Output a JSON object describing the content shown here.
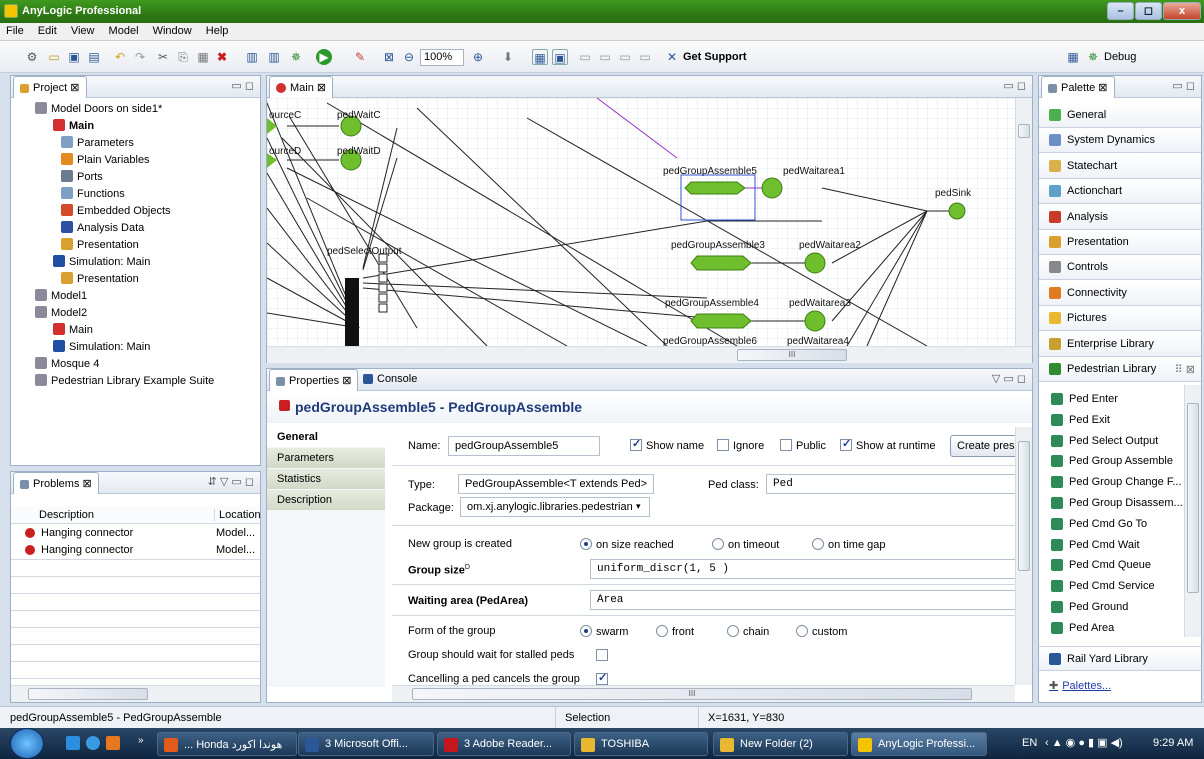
{
  "window": {
    "title": "AnyLogic Professional",
    "min": "–",
    "max": "◻",
    "close": "x"
  },
  "menu": [
    "File",
    "Edit",
    "View",
    "Model",
    "Window",
    "Help"
  ],
  "toolbar": {
    "zoom": "100%",
    "get_support": "Get Support",
    "perspective": "Debug"
  },
  "project": {
    "tab": "Project",
    "items": [
      {
        "label": "Model Doors on side1*",
        "color": "#8a8a9a"
      },
      {
        "label": "Main",
        "color": "#d32f2f",
        "bold": true
      },
      {
        "label": "Parameters",
        "color": "#7ea0c4"
      },
      {
        "label": "Plain Variables",
        "color": "#e58a1f"
      },
      {
        "label": "Ports",
        "color": "#6b7a8f"
      },
      {
        "label": "Functions",
        "color": "#7ea0c4"
      },
      {
        "label": "Embedded Objects",
        "color": "#d34b2a"
      },
      {
        "label": "Analysis Data",
        "color": "#2f4fa3"
      },
      {
        "label": "Presentation",
        "color": "#d9a030"
      },
      {
        "label": "Simulation: Main",
        "color": "#1f4fa3"
      },
      {
        "label": "Presentation",
        "color": "#d9a030"
      },
      {
        "label": "Model1",
        "color": "#8a8a9a"
      },
      {
        "label": "Model2",
        "color": "#8a8a9a"
      },
      {
        "label": "Main",
        "color": "#d32f2f"
      },
      {
        "label": "Simulation: Main",
        "color": "#1f4fa3"
      },
      {
        "label": "Mosque 4",
        "color": "#8a8a9a"
      },
      {
        "label": "Pedestrian Library Example Suite",
        "color": "#8a8a9a"
      }
    ]
  },
  "problems": {
    "tab": "Problems",
    "col_description": "Description",
    "col_location": "Location",
    "rows": [
      {
        "description": "Hanging connector",
        "location": "Model..."
      },
      {
        "description": "Hanging connector",
        "location": "Model..."
      }
    ]
  },
  "editor": {
    "tab": "Main",
    "labels": {
      "sourceC": "ourceC",
      "sourceD": "ourceD",
      "waitC": "pedWaitC",
      "waitD": "pedWaitD",
      "select": "pedSelectOutput",
      "ga5": "pedGroupAssemble5",
      "ga3": "pedGroupAssemble3",
      "ga4": "pedGroupAssemble4",
      "ga6": "pedGroupAssemble6",
      "wa1": "pedWaitarea1",
      "wa2": "pedWaitarea2",
      "wa3": "pedWaitarea3",
      "wa4": "pedWaitarea4",
      "sink": "pedSink"
    },
    "hscroll_mark": "III"
  },
  "properties": {
    "tab": "Properties",
    "console_tab": "Console",
    "title": "pedGroupAssemble5 - PedGroupAssemble",
    "sections": [
      "General",
      "Parameters",
      "Statistics",
      "Description"
    ],
    "name_label": "Name:",
    "name_value": "pedGroupAssemble5",
    "show_name": "Show name",
    "ignore": "Ignore",
    "public": "Public",
    "show_at_runtime": "Show at runtime",
    "create_btn": "Create prese",
    "type_label": "Type:",
    "type_value": "PedGroupAssemble<T extends Ped>",
    "pedclass_label": "Ped class:",
    "pedclass_value": "Ped",
    "package_label": "Package:",
    "package_value": "om.xj.anylogic.libraries.pedestrian",
    "new_group_label": "New group is created",
    "opt_size": "on size reached",
    "opt_timeout": "on timeout",
    "opt_gap": "on time gap",
    "group_size_label": "Group size",
    "group_size_sup": "D",
    "group_size_value": "uniform_discr(1, 5 )",
    "waiting_label": "Waiting area (PedArea)",
    "waiting_value": "Area",
    "form_label": "Form of the group",
    "form_swarm": "swarm",
    "form_front": "front",
    "form_chain": "chain",
    "form_custom": "custom",
    "stalled_label": "Group should wait for stalled peds",
    "cancel_label": "Cancelling a ped cancels the group",
    "hscroll_mark": "III"
  },
  "palette": {
    "tab": "Palette",
    "sections": [
      {
        "label": "General",
        "color": "#4caf50"
      },
      {
        "label": "System Dynamics",
        "color": "#6d8fc8"
      },
      {
        "label": "Statechart",
        "color": "#d9b04a"
      },
      {
        "label": "Actionchart",
        "color": "#5fa0c8"
      },
      {
        "label": "Analysis",
        "color": "#c83a2a"
      },
      {
        "label": "Presentation",
        "color": "#d9a030"
      },
      {
        "label": "Controls",
        "color": "#888888"
      },
      {
        "label": "Connectivity",
        "color": "#e07b20"
      },
      {
        "label": "Pictures",
        "color": "#e8b830"
      },
      {
        "label": "Enterprise Library",
        "color": "#c8a030"
      },
      {
        "label": "Pedestrian Library",
        "color": "#2e8b2e"
      }
    ],
    "ped_items": [
      {
        "label": "Ped Enter",
        "color": "#2e8b57"
      },
      {
        "label": "Ped Exit",
        "color": "#2e8b57"
      },
      {
        "label": "Ped Select Output",
        "color": "#2e8b57"
      },
      {
        "label": "Ped Group Assemble",
        "color": "#2e8b57"
      },
      {
        "label": "Ped Group Change F...",
        "color": "#2e8b57"
      },
      {
        "label": "Ped Group Disassem...",
        "color": "#2e8b57"
      },
      {
        "label": "Ped Cmd Go To",
        "color": "#2e8b57"
      },
      {
        "label": "Ped Cmd Wait",
        "color": "#2e8b57"
      },
      {
        "label": "Ped Cmd Queue",
        "color": "#2e8b57"
      },
      {
        "label": "Ped Cmd Service",
        "color": "#2e8b57"
      },
      {
        "label": "Ped Ground",
        "color": "#2e8b57"
      },
      {
        "label": "Ped Area",
        "color": "#2e8b57"
      }
    ],
    "rail": "Rail Yard Library",
    "palettes_link": "Palettes..."
  },
  "status": {
    "left": "pedGroupAssemble5 - PedGroupAssemble",
    "mode": "Selection",
    "coords": "X=1631, Y=830"
  },
  "taskbar": {
    "tasks": [
      {
        "label": "... Honda هوندا اكورد",
        "color": "#e25a1c"
      },
      {
        "label": "3 Microsoft Offi...",
        "color": "#2b5797"
      },
      {
        "label": "3 Adobe Reader...",
        "color": "#c4161c"
      },
      {
        "label": "TOSHIBA",
        "color": "#e8b830"
      },
      {
        "label": "New Folder (2)",
        "color": "#e8b830"
      },
      {
        "label": "AnyLogic Professi...",
        "color": "#f5c400"
      }
    ],
    "lang": "EN",
    "time": "9:29 AM"
  }
}
